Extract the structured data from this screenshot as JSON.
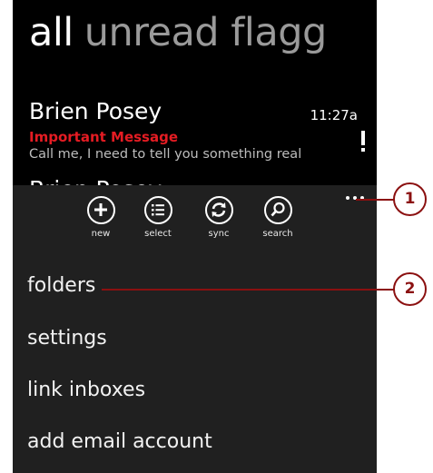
{
  "pivot": {
    "active": "all",
    "rest": "unread flagg"
  },
  "message": {
    "sender": "Brien Posey",
    "time": "11:27a",
    "subject": "Important Message",
    "preview": "Call me, I need to tell you something real",
    "next_sender": "Brien Posey"
  },
  "appbar": {
    "buttons": [
      {
        "label": "new",
        "icon": "plus-icon"
      },
      {
        "label": "select",
        "icon": "select-list-icon"
      },
      {
        "label": "sync",
        "icon": "sync-icon"
      },
      {
        "label": "search",
        "icon": "search-icon"
      }
    ],
    "menu": [
      "folders",
      "settings",
      "link inboxes",
      "add email account"
    ]
  },
  "callouts": [
    "1",
    "2"
  ],
  "colors": {
    "accent_red": "#e51c23",
    "callout": "#8b1010",
    "appbar_bg": "#202020"
  }
}
